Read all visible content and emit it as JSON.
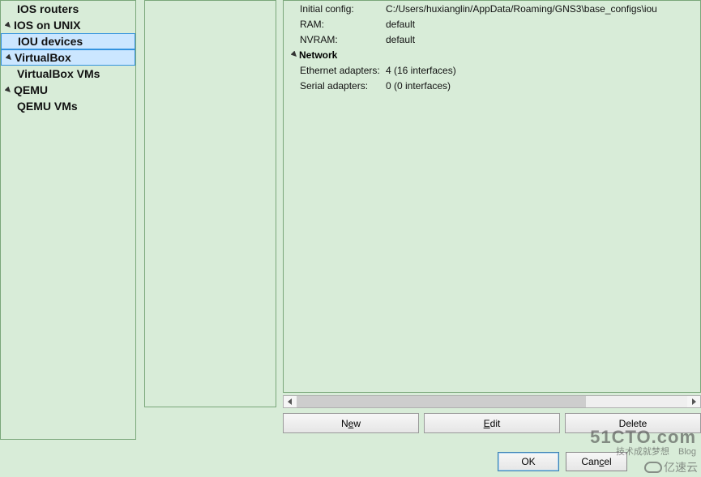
{
  "tree": {
    "ios_routers": "IOS routers",
    "ios_on_unix": "IOS on UNIX",
    "iou_devices": "IOU devices",
    "virtualbox": "VirtualBox",
    "virtualbox_vms": "VirtualBox VMs",
    "qemu": "QEMU",
    "qemu_vms": "QEMU VMs"
  },
  "details": {
    "initial_config": {
      "label": "Initial config:",
      "value": "C:/Users/huxianglin/AppData/Roaming/GNS3\\base_configs\\iou"
    },
    "ram": {
      "label": "RAM:",
      "value": "default"
    },
    "nvram": {
      "label": "NVRAM:",
      "value": "default"
    },
    "network_section": "Network",
    "ethernet": {
      "label": "Ethernet adapters:",
      "value": "4 (16 interfaces)"
    },
    "serial": {
      "label": "Serial adapters:",
      "value": "0 (0 interfaces)"
    }
  },
  "buttons": {
    "new_pre": "N",
    "new_ul": "e",
    "new_post": "w",
    "edit_pre": "",
    "edit_ul": "E",
    "edit_post": "dit",
    "delete_label": "Delete"
  },
  "dialog": {
    "ok": "OK",
    "cancel_pre": "Can",
    "cancel_ul": "c",
    "cancel_post": "el"
  },
  "watermark": {
    "main": "51CTO.com",
    "sub": "技术成就梦想　Blog",
    "cloud": "亿速云"
  }
}
